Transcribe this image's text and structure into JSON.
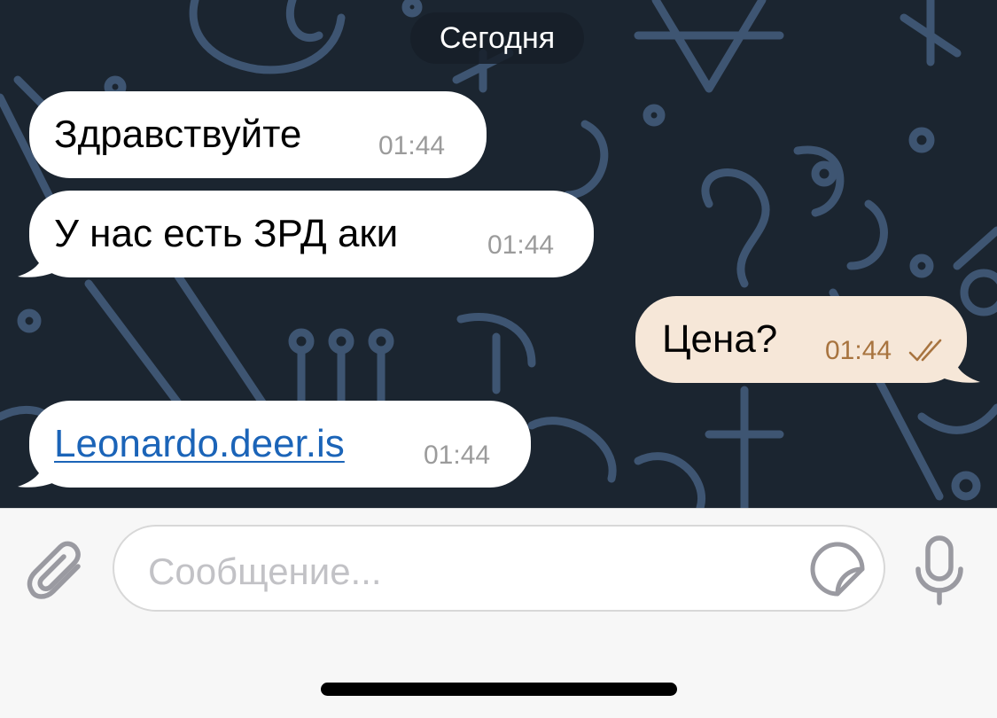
{
  "chat": {
    "date_separator": "Сегодня",
    "messages": [
      {
        "direction": "incoming",
        "text": "Здравствуйте",
        "time": "01:44"
      },
      {
        "direction": "incoming",
        "text": "У нас есть ЗРД аки",
        "time": "01:44"
      },
      {
        "direction": "outgoing",
        "text": "Цена?",
        "time": "01:44",
        "status": "read-double-check"
      },
      {
        "direction": "incoming",
        "text": "Leonardo.deer.is",
        "time": "01:44",
        "is_link": true
      }
    ]
  },
  "composer": {
    "placeholder": "Сообщение...",
    "icons": {
      "attach": "paperclip-icon",
      "sticker": "sticker-icon",
      "voice": "microphone-icon"
    }
  },
  "colors": {
    "chat_background": "#1b2530",
    "wallpaper_doodle": "#3e5572",
    "incoming_bubble": "#ffffff",
    "outgoing_bubble": "#f6e7d8",
    "outgoing_time": "#a8743f",
    "link": "#1b64b8",
    "composer_background": "#f7f7f7",
    "placeholder": "#c2c2c6"
  }
}
